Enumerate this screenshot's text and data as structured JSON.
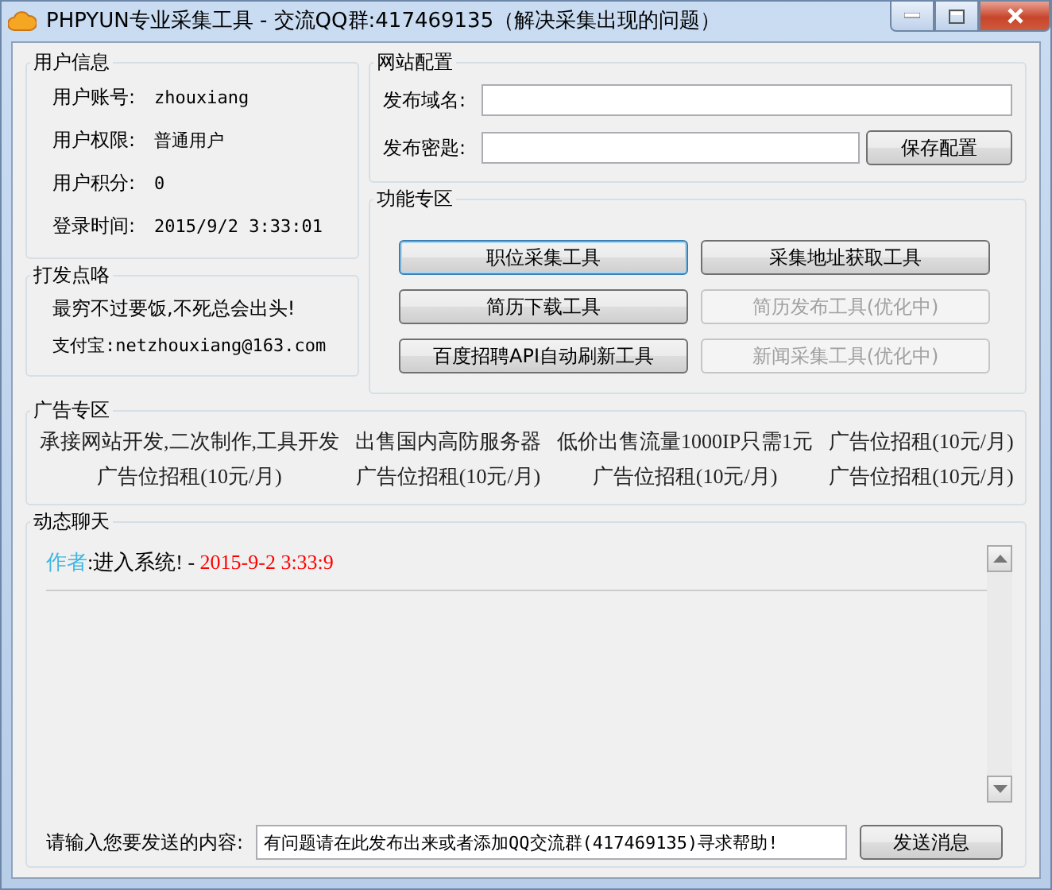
{
  "window": {
    "title": "PHPYUN专业采集工具 - 交流QQ群:417469135（解决采集出现的问题）"
  },
  "user_info": {
    "title": "用户信息",
    "rows": [
      {
        "label": "用户账号:",
        "value": "zhouxiang"
      },
      {
        "label": "用户权限:",
        "value": "普通用户"
      },
      {
        "label": "用户积分:",
        "value": "0"
      },
      {
        "label": "登录时间:",
        "value": "2015/9/2 3:33:01"
      }
    ]
  },
  "tips": {
    "title": "打发点咯",
    "lines": [
      "最穷不过要饭,不死总会出头!",
      "支付宝:netzhouxiang@163.com"
    ]
  },
  "site_config": {
    "title": "网站配置",
    "domain_label": "发布域名:",
    "key_label": "发布密匙:",
    "save_button": "保存配置"
  },
  "tools": {
    "title": "功能专区",
    "buttons": [
      {
        "label": "职位采集工具",
        "focused": true,
        "disabled": false
      },
      {
        "label": "采集地址获取工具",
        "focused": false,
        "disabled": false
      },
      {
        "label": "简历下载工具",
        "focused": false,
        "disabled": false
      },
      {
        "label": "简历发布工具(优化中)",
        "focused": false,
        "disabled": true
      },
      {
        "label": "百度招聘API自动刷新工具",
        "focused": false,
        "disabled": false
      },
      {
        "label": "新闻采集工具(优化中)",
        "focused": false,
        "disabled": true
      }
    ]
  },
  "ads": {
    "title": "广告专区",
    "items": [
      "承接网站开发,二次制作,工具开发",
      "出售国内高防服务器",
      "低价出售流量1000IP只需1元",
      "广告位招租(10元/月)",
      "广告位招租(10元/月)",
      "广告位招租(10元/月)",
      "广告位招租(10元/月)",
      "广告位招租(10元/月)"
    ]
  },
  "chat": {
    "title": "动态聊天",
    "messages": [
      [
        {
          "text": "作者",
          "color": "#3fb6e0"
        },
        {
          "text": ":进入系统! - ",
          "color": "#000000"
        },
        {
          "text": "2015-9-2 3:33:9",
          "color": "#ff0000"
        }
      ]
    ],
    "input_label": "请输入您要发送的内容:",
    "input_value": "有问题请在此发布出来或者添加QQ交流群(417469135)寻求帮助!",
    "send_button": "发送消息"
  }
}
